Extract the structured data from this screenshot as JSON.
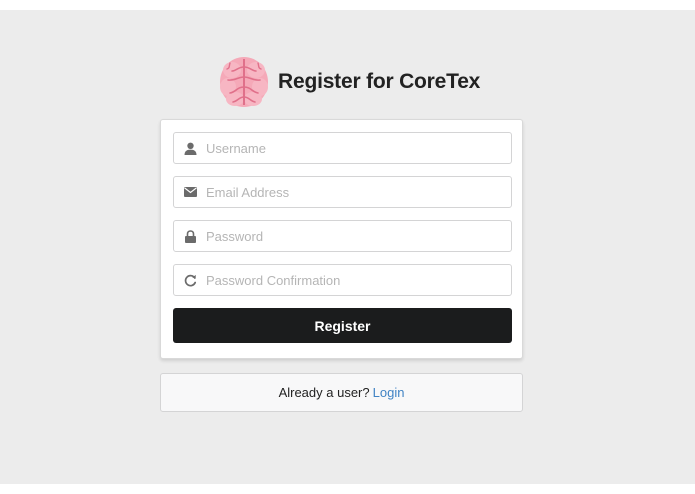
{
  "header": {
    "title": "Register for CoreTex",
    "logo_icon": "brain-icon",
    "logo_color": "#f4a3b5"
  },
  "form": {
    "username": {
      "placeholder": "Username",
      "value": "",
      "icon": "user-icon"
    },
    "email": {
      "placeholder": "Email Address",
      "value": "",
      "icon": "envelope-icon"
    },
    "password": {
      "placeholder": "Password",
      "value": "",
      "icon": "lock-icon"
    },
    "password_confirmation": {
      "placeholder": "Password Confirmation",
      "value": "",
      "icon": "refresh-icon"
    },
    "submit_label": "Register",
    "submit_color": "#1b1c1d"
  },
  "login_prompt": {
    "text": "Already a user?",
    "link_label": "Login",
    "link_color": "#4183c4"
  }
}
